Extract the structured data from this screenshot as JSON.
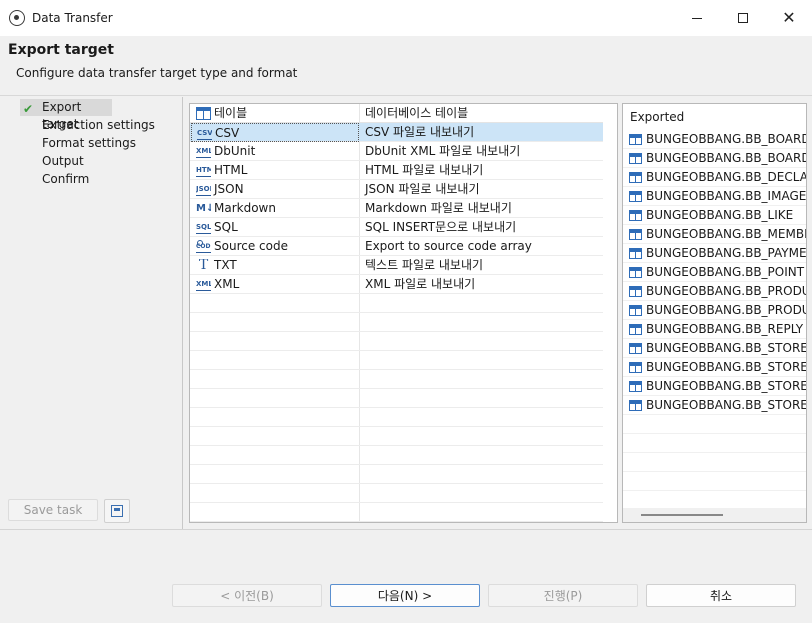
{
  "window": {
    "title": "Data Transfer"
  },
  "header": {
    "title": "Export target",
    "subtitle": "Configure data transfer target type and format"
  },
  "steps": [
    {
      "label": "Export target",
      "selected": true
    },
    {
      "label": "Extraction settings"
    },
    {
      "label": "Format settings"
    },
    {
      "label": "Output"
    },
    {
      "label": "Confirm"
    }
  ],
  "left_actions": {
    "save_task": "Save task"
  },
  "type_table": {
    "columns": [
      "테이블",
      "데이터베이스 테이블"
    ],
    "rows": [
      {
        "icon": "csv-icon",
        "icon_text": "CSV",
        "name": "CSV",
        "description": "CSV 파일로 내보내기",
        "selected": true
      },
      {
        "icon": "xml-icon",
        "icon_text": "XML",
        "name": "DbUnit",
        "description": "DbUnit XML 파일로 내보내기"
      },
      {
        "icon": "html-icon",
        "icon_text": "HTML",
        "name": "HTML",
        "description": "HTML 파일로 내보내기"
      },
      {
        "icon": "json-icon",
        "icon_text": "JSON",
        "name": "JSON",
        "description": "JSON 파일로 내보내기"
      },
      {
        "icon": "markdown-icon",
        "icon_text": "M↓",
        "name": "Markdown",
        "description": "Markdown 파일로 내보내기"
      },
      {
        "icon": "sql-icon",
        "icon_text": "SQL",
        "name": "SQL",
        "description": "SQL INSERT문으로 내보내기"
      },
      {
        "icon": "code-icon",
        "icon_text": "CODE",
        "name": "Source code",
        "description": "Export to source code array"
      },
      {
        "icon": "txt-icon",
        "icon_text": "T",
        "name": "TXT",
        "description": "텍스트 파일로 내보내기"
      },
      {
        "icon": "xml-icon",
        "icon_text": "XML",
        "name": "XML",
        "description": "XML 파일로 내보내기"
      }
    ]
  },
  "exported": {
    "header": "Exported",
    "items": [
      "BUNGEOBBANG.BB_BOARD",
      "BUNGEOBBANG.BB_BOARD_C",
      "BUNGEOBBANG.BB_DECLARE",
      "BUNGEOBBANG.BB_IMAGE",
      "BUNGEOBBANG.BB_LIKE",
      "BUNGEOBBANG.BB_MEMBER",
      "BUNGEOBBANG.BB_PAYMENT",
      "BUNGEOBBANG.BB_POINT",
      "BUNGEOBBANG.BB_PRODUCT",
      "BUNGEOBBANG.BB_PRODUCT",
      "BUNGEOBBANG.BB_REPLY",
      "BUNGEOBBANG.BB_STORE",
      "BUNGEOBBANG.BB_STORE_MI",
      "BUNGEOBBANG.BB_STORE_PA",
      "BUNGEOBBANG.BB_STORE_WO"
    ]
  },
  "footer": {
    "prev": "< 이전(B)",
    "next": "다음(N) >",
    "proceed": "진행(P)",
    "cancel": "취소"
  }
}
